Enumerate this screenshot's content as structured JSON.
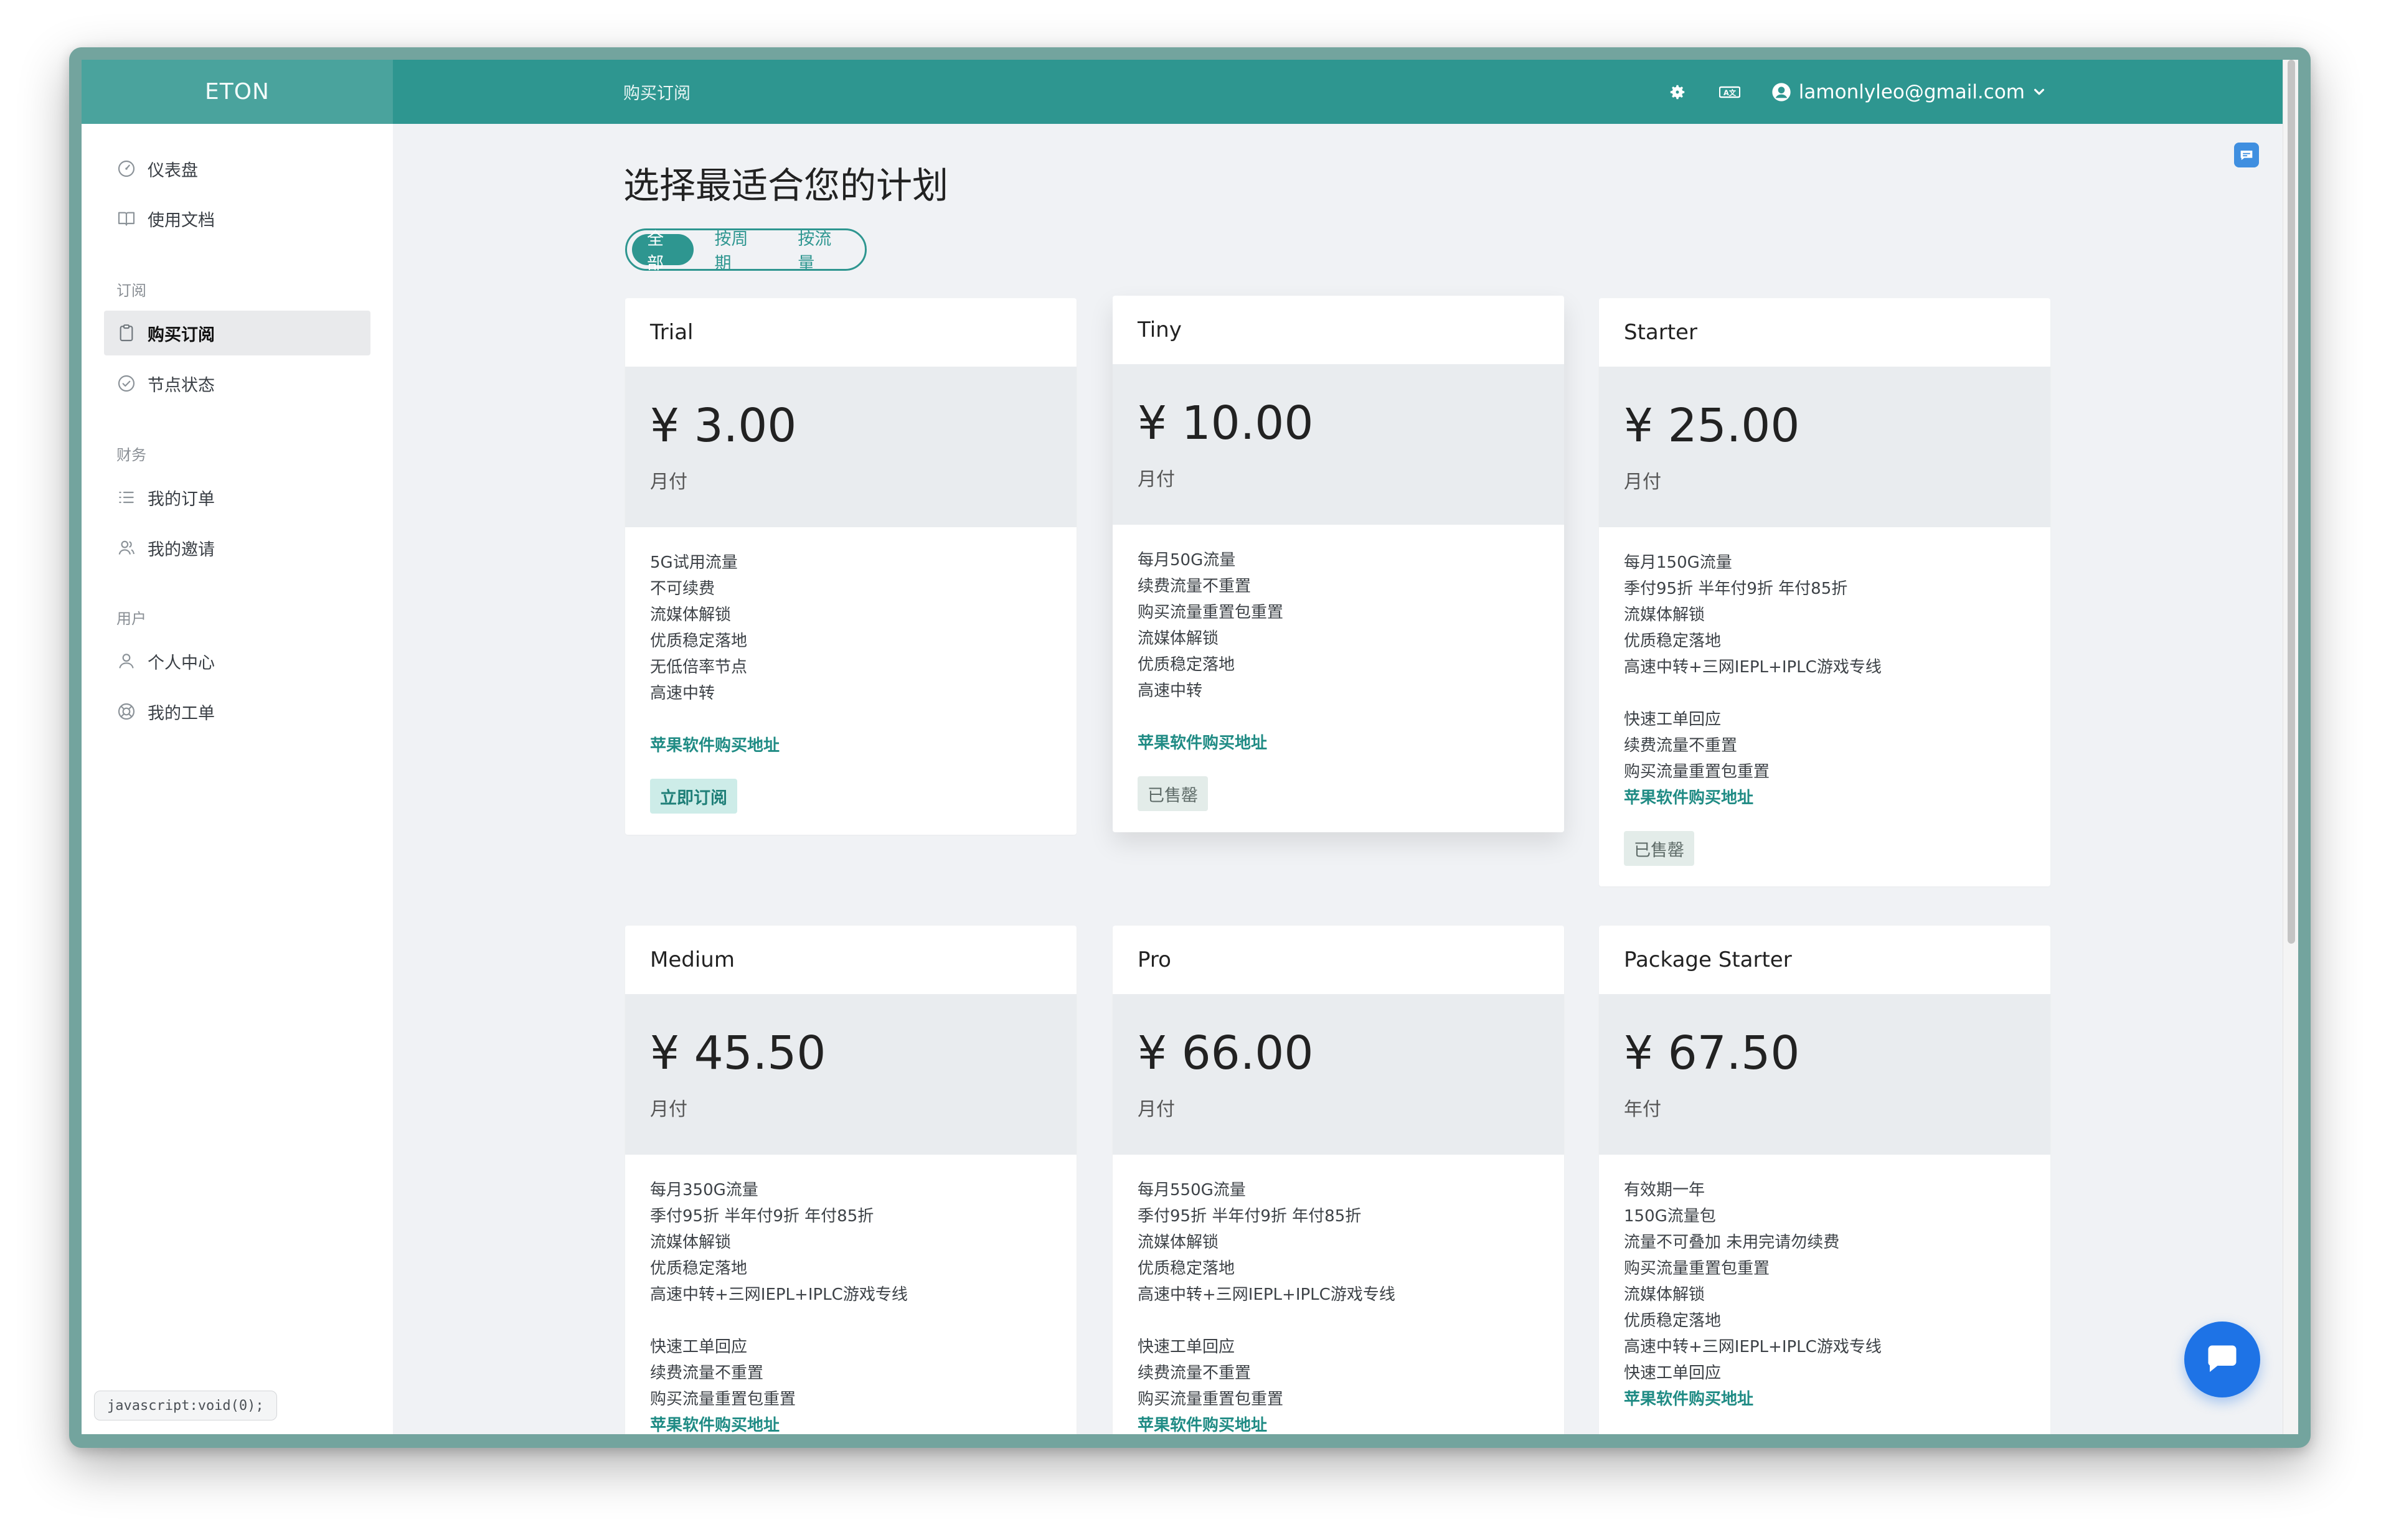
{
  "app": {
    "brand": "ETON",
    "page_title": "购买订阅"
  },
  "header": {
    "user_email": "lamonlyleo@gmail.com",
    "settings_icon": "gear-icon",
    "language_icon": "translate-icon"
  },
  "sidebar": {
    "top_items": [
      {
        "label": "仪表盘",
        "icon": "dashboard-gauge-icon"
      },
      {
        "label": "使用文档",
        "icon": "book-icon"
      }
    ],
    "groups": [
      {
        "title": "订阅",
        "items": [
          {
            "label": "购买订阅",
            "icon": "clipboard-icon",
            "active": true
          },
          {
            "label": "节点状态",
            "icon": "check-circle-icon"
          }
        ]
      },
      {
        "title": "财务",
        "items": [
          {
            "label": "我的订单",
            "icon": "list-icon"
          },
          {
            "label": "我的邀请",
            "icon": "users-icon"
          }
        ]
      },
      {
        "title": "用户",
        "items": [
          {
            "label": "个人中心",
            "icon": "user-icon"
          },
          {
            "label": "我的工单",
            "icon": "lifebuoy-icon"
          }
        ]
      }
    ]
  },
  "status_tip": "javascript:void(0);",
  "main": {
    "heading": "选择最适合您的计划",
    "filter_tabs": [
      {
        "label": "全部",
        "active": true
      },
      {
        "label": "按周期",
        "active": false
      },
      {
        "label": "按流量",
        "active": false
      }
    ]
  },
  "plans": [
    {
      "name": "Trial",
      "price": "¥ 3.00",
      "period": "月付",
      "features": [
        "5G试用流量",
        "不可续费",
        "流媒体解锁",
        "优质稳定落地",
        "无低倍率节点",
        "高速中转",
        "",
        "苹果软件购买地址"
      ],
      "action": "立即订阅",
      "action_type": "subscribe"
    },
    {
      "name": "Tiny",
      "price": "¥ 10.00",
      "period": "月付",
      "features": [
        "每月50G流量",
        "续费流量不重置",
        "购买流量重置包重置",
        "流媒体解锁",
        "优质稳定落地",
        "高速中转",
        "",
        "苹果软件购买地址"
      ],
      "action": "已售罄",
      "action_type": "soldout"
    },
    {
      "name": "Starter",
      "price": "¥ 25.00",
      "period": "月付",
      "features": [
        "每月150G流量",
        "季付95折 半年付9折 年付85折",
        "流媒体解锁",
        "优质稳定落地",
        "高速中转+三网IEPL+IPLC游戏专线",
        "",
        "快速工单回应",
        "续费流量不重置",
        "购买流量重置包重置",
        "苹果软件购买地址"
      ],
      "action": "已售罄",
      "action_type": "soldout"
    },
    {
      "name": "Medium",
      "price": "¥ 45.50",
      "period": "月付",
      "features": [
        "每月350G流量",
        "季付95折 半年付9折 年付85折",
        "流媒体解锁",
        "优质稳定落地",
        "高速中转+三网IEPL+IPLC游戏专线",
        "",
        "快速工单回应",
        "续费流量不重置",
        "购买流量重置包重置",
        "苹果软件购买地址"
      ]
    },
    {
      "name": "Pro",
      "price": "¥ 66.00",
      "period": "月付",
      "features": [
        "每月550G流量",
        "季付95折 半年付9折 年付85折",
        "流媒体解锁",
        "优质稳定落地",
        "高速中转+三网IEPL+IPLC游戏专线",
        "",
        "快速工单回应",
        "续费流量不重置",
        "购买流量重置包重置",
        "苹果软件购买地址"
      ]
    },
    {
      "name": "Package Starter",
      "price": "¥ 67.50",
      "period": "年付",
      "features": [
        "有效期一年",
        "150G流量包",
        "流量不可叠加 未用完请勿续费",
        "购买流量重置包重置",
        "流媒体解锁",
        "优质稳定落地",
        "高速中转+三网IEPL+IPLC游戏专线",
        "快速工单回应",
        "苹果软件购买地址"
      ]
    }
  ],
  "colors": {
    "accent": "#2e9690",
    "brand_block": "#4aa39d",
    "link": "#1f8b84",
    "chat": "#1e73e6"
  }
}
